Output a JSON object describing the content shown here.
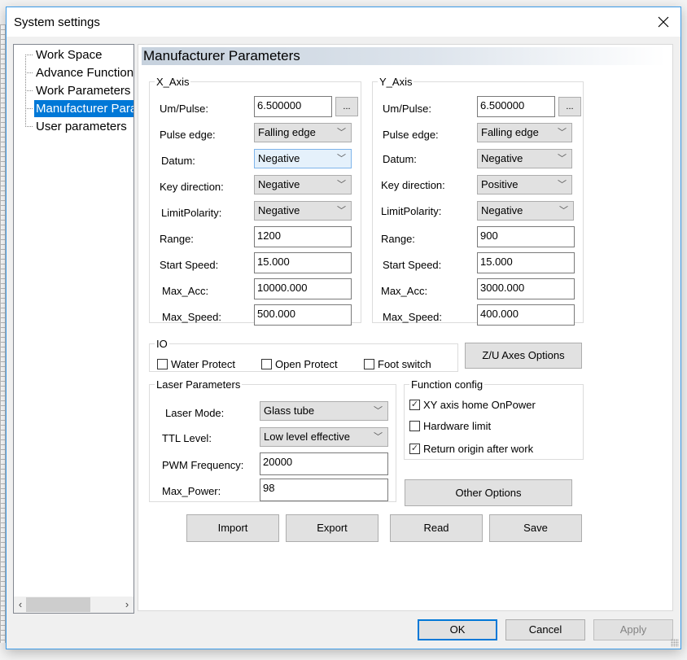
{
  "window": {
    "title": "System settings",
    "close_icon": "close-x-icon"
  },
  "tree": {
    "items": [
      {
        "label": "Work Space",
        "selected": false
      },
      {
        "label": "Advance Functions",
        "selected": false
      },
      {
        "label": "Work Parameters",
        "selected": false
      },
      {
        "label": "Manufacturer Parameters",
        "selected": true
      },
      {
        "label": "User parameters",
        "selected": false
      }
    ],
    "scroll_left_icon": "‹",
    "scroll_right_icon": "›"
  },
  "panel": {
    "title": "Manufacturer Parameters",
    "x_axis": {
      "legend": "X_Axis",
      "um_pulse_label": "Um/Pulse:",
      "um_pulse": "6.500000",
      "browse_label": "...",
      "pulse_edge_label": "Pulse edge:",
      "pulse_edge": "Falling edge",
      "datum_label": "Datum:",
      "datum": "Negative",
      "key_direction_label": "Key direction:",
      "key_direction": "Negative",
      "limit_polarity_label": "LimitPolarity:",
      "limit_polarity": "Negative",
      "range_label": "Range:",
      "range": "1200",
      "start_speed_label": "Start Speed:",
      "start_speed": "15.000",
      "max_acc_label": "Max_Acc:",
      "max_acc": "10000.000",
      "max_speed_label": "Max_Speed:",
      "max_speed": "500.000"
    },
    "y_axis": {
      "legend": "Y_Axis",
      "um_pulse_label": "Um/Pulse:",
      "um_pulse": "6.500000",
      "browse_label": "...",
      "pulse_edge_label": "Pulse edge:",
      "pulse_edge": "Falling edge",
      "datum_label": "Datum:",
      "datum": "Negative",
      "key_direction_label": "Key direction:",
      "key_direction": "Positive",
      "limit_polarity_label": "LimitPolarity:",
      "limit_polarity": "Negative",
      "range_label": "Range:",
      "range": "900",
      "start_speed_label": "Start Speed:",
      "start_speed": "15.000",
      "max_acc_label": "Max_Acc:",
      "max_acc": "3000.000",
      "max_speed_label": "Max_Speed:",
      "max_speed": "400.000"
    },
    "io": {
      "legend": "IO",
      "water_protect": {
        "label": "Water Protect",
        "checked": false
      },
      "open_protect": {
        "label": "Open Protect",
        "checked": false
      },
      "foot_switch": {
        "label": "Foot switch",
        "checked": false
      }
    },
    "zu_axes_button": "Z/U Axes Options",
    "laser": {
      "legend": "Laser Parameters",
      "laser_mode_label": "Laser Mode:",
      "laser_mode": "Glass tube",
      "ttl_level_label": "TTL Level:",
      "ttl_level": "Low level effective",
      "pwm_frequency_label": "PWM Frequency:",
      "pwm_frequency": "20000",
      "max_power_label": "Max_Power:",
      "max_power": "98"
    },
    "function_config": {
      "legend": "Function config",
      "xy_home": {
        "label": "XY axis home OnPower",
        "checked": true
      },
      "hardware_limit": {
        "label": "Hardware limit",
        "checked": false
      },
      "return_origin": {
        "label": "Return origin after work",
        "checked": true
      }
    },
    "other_options_button": "Other Options",
    "actions": {
      "import": "Import",
      "export": "Export",
      "read": "Read",
      "save": "Save"
    }
  },
  "footer": {
    "ok": "OK",
    "cancel": "Cancel",
    "apply": "Apply"
  },
  "icons": {
    "chevron_down": "﹀",
    "check": "✓"
  }
}
